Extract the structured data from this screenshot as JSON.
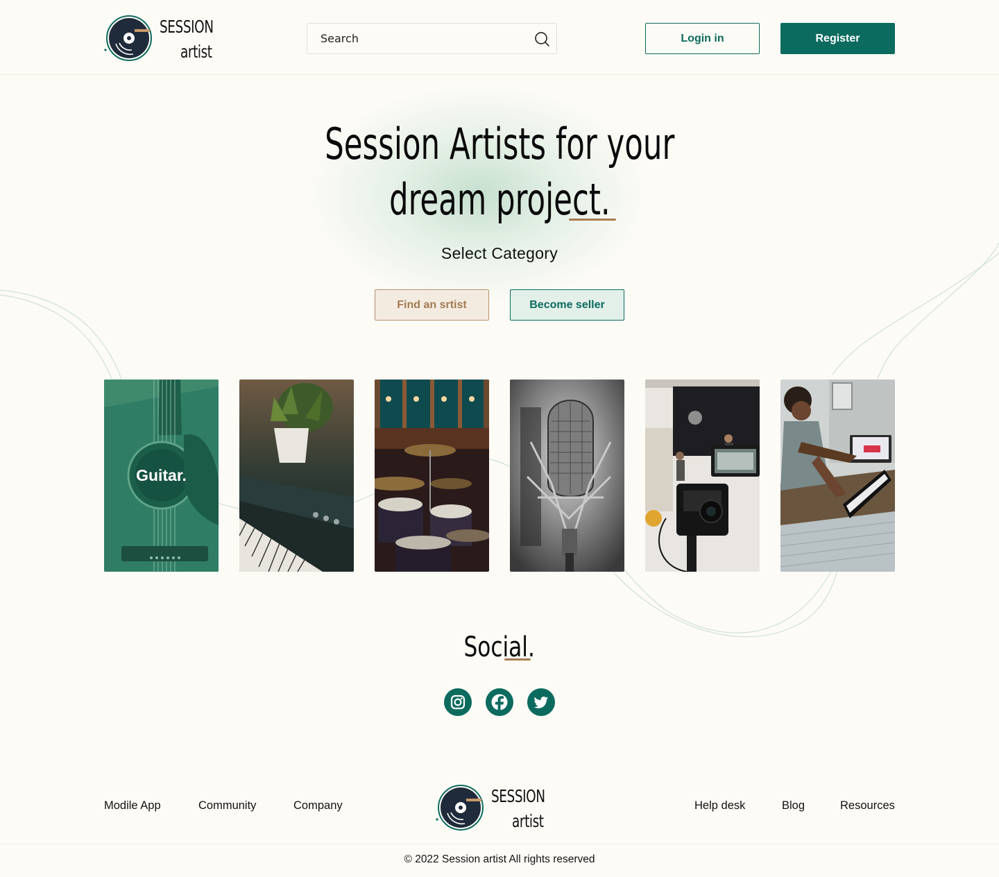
{
  "header": {
    "logo": {
      "line1": "SESSION",
      "line2": "artist"
    },
    "search": {
      "placeholder": "Search"
    },
    "login_label": "Login in",
    "register_label": "Register"
  },
  "hero": {
    "title_line1": "Session Artists for your",
    "title_line2": "dream project.",
    "subtitle": "Select Category",
    "find_label": "Find an srtist",
    "seller_label": "Become seller"
  },
  "categories": [
    {
      "label": "Guitar.",
      "icon": "guitar-image"
    },
    {
      "label": "",
      "icon": "piano-image"
    },
    {
      "label": "",
      "icon": "drums-image"
    },
    {
      "label": "",
      "icon": "microphone-image"
    },
    {
      "label": "",
      "icon": "camera-image"
    },
    {
      "label": "",
      "icon": "keyboard-player-image"
    }
  ],
  "social": {
    "title": "Social.",
    "icons": [
      "instagram-icon",
      "facebook-icon",
      "twitter-icon"
    ]
  },
  "footer": {
    "left_links": [
      "Modile App",
      "Community",
      "Company"
    ],
    "right_links": [
      "Help desk",
      "Blog",
      "Resources"
    ],
    "logo": {
      "line1": "SESSION",
      "line2": "artist"
    },
    "copyright": "© 2022 Session artist All rights reserved"
  },
  "colors": {
    "accent": "#0b6b5e",
    "accent_light": "#e3efe9",
    "brown": "#a87b4f",
    "brown_light": "#f4ebe0",
    "background": "#fdfbf6"
  }
}
